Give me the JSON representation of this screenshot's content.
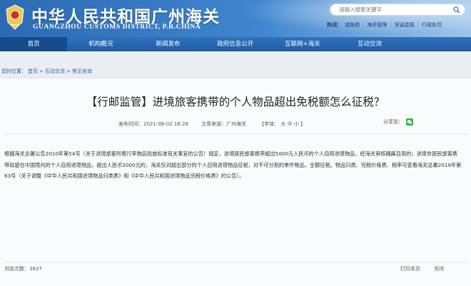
{
  "header": {
    "title": "中华人民共和国广州海关",
    "subtitle": "GUANGZHOU CUSTOMS DISTRICT, P.R.CHINA",
    "emblem_icon": "customs-emblem-icon"
  },
  "search": {
    "placeholder": "请输入搜索关键字",
    "icon": "search-icon"
  },
  "hotlinks": {
    "label": "热词：",
    "items": [
      "减免税",
      "海关管理",
      "货运监管",
      "行政处罚"
    ]
  },
  "nav": {
    "items": [
      "首页",
      "机构概况",
      "新闻发布",
      "政府信息公开",
      "互联网+海关",
      "互动交流"
    ]
  },
  "breadcrumb": {
    "prefix": "您的位置：",
    "items": [
      "首页",
      "互动交流",
      "常见咨询"
    ],
    "separator": ">"
  },
  "article": {
    "title": "【行邮监管】进境旅客携带的个人物品超出免税额怎么征税？",
    "date_label": "发布时间：",
    "date": "2021-08-02 16:26",
    "source_label": "文章来源：",
    "source": "广州海关",
    "font_label": "【字体：",
    "font_sizes": [
      "大",
      "中",
      "小"
    ],
    "font_end": "】",
    "share_label": "分享到：",
    "share_icon": "wechat-icon",
    "body": "根据海关总署公告2010年第54号（关于进境旅客所携行李物品验放标准有关事宜的公告）规定，进境居民旅客携带超出5000元人民币的个人自用进境物品，经海关审核确属自用的；进境非居民旅客携带拟留在中国境内的个人自用进境物品，超出人民币2000元的，海关仅对超出部分的个人自用进境物品征税，对不可分割的单件物品，全额征税。物品归类、完税价格表、税率可查看海关总署2019年第63号（关于调整《中华人民共和国进境物品归类表》和《中华人民共和国进境物品完税价格表》的公告）。"
  },
  "footer": {
    "views_label": "浏览次数：",
    "views": "3637",
    "print": "打印本页",
    "close": "关闭"
  },
  "colors": {
    "nav_bg": "#1f5ca3",
    "nav_active": "#144c8c",
    "wechat": "#2fb53f"
  }
}
